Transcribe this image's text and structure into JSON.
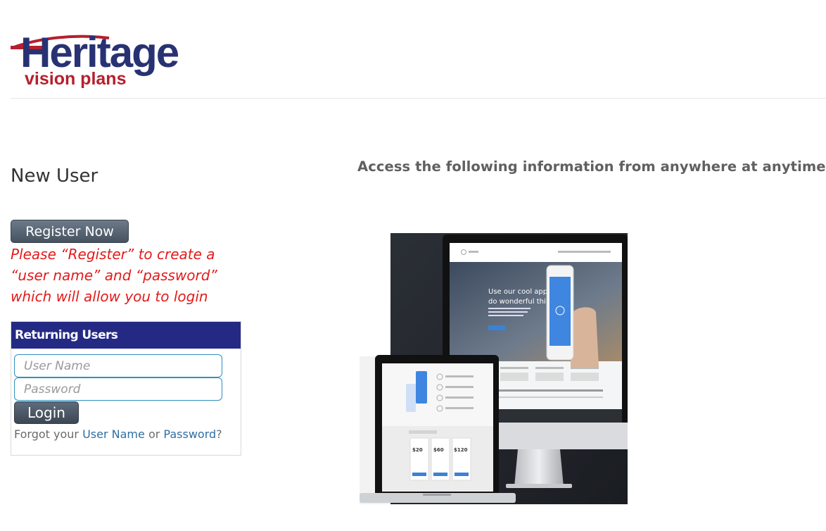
{
  "brand": {
    "logo_wordmark": "Heritage",
    "logo_subtitle": "vision plans",
    "colors": {
      "navy": "#283273",
      "red": "#b51f2e"
    }
  },
  "new_user": {
    "heading": "New User",
    "register_button": "Register Now",
    "note": "Please “Register” to create a “user name” and “password” which will allow you to login"
  },
  "login": {
    "panel_title": "Returning Users",
    "username_placeholder": "User Name",
    "password_placeholder": "Password",
    "login_button": "Login",
    "forgot_prefix": "Forgot your ",
    "forgot_username_link": "User Name",
    "forgot_or": " or ",
    "forgot_password_link": "Password",
    "forgot_suffix": "?"
  },
  "promo": {
    "tagline": "Access the following information from anywhere at anytime!",
    "monitor_headline_line1": "Use our cool app to",
    "monitor_headline_line2": "do wonderful things.",
    "laptop_prices": [
      "$20",
      "$60",
      "$120"
    ]
  },
  "colors": {
    "panel_header": "#242a84",
    "note_red": "#e21b1b",
    "link_blue": "#2f6fa3",
    "input_border": "#2f8fc1"
  }
}
